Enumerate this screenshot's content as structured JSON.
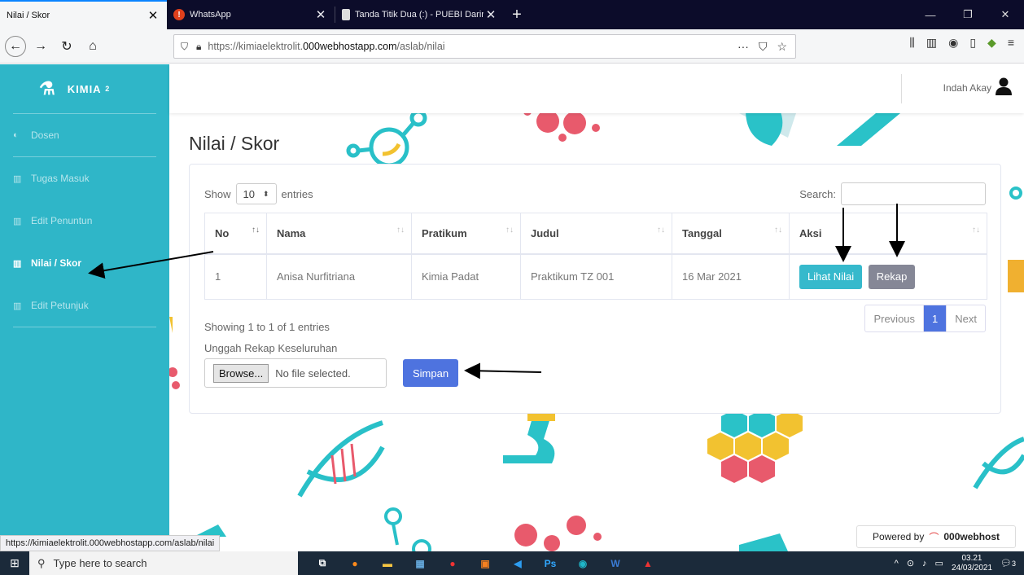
{
  "browser": {
    "tabs": [
      {
        "title": "Nilai / Skor",
        "icon": "page-icon"
      },
      {
        "title": "WhatsApp",
        "icon": "whatsapp-alert-icon"
      },
      {
        "title": "Tanda Titik Dua (:) - PUEBI Darin",
        "icon": "document-icon"
      }
    ],
    "url_prefix": "https://kimiaelektrolit.",
    "url_domain": "000webhostapp.com",
    "url_path": "/aslab/nilai",
    "status_url": "https://kimiaelektrolit.000webhostapp.com/aslab/nilai"
  },
  "app": {
    "brand": "KIMIA",
    "brand_sup": "2",
    "user_name": "Indah Akay",
    "sidebar": [
      {
        "label": "Dosen",
        "icon": "palette-icon",
        "active": false
      },
      {
        "label": "Tugas Masuk",
        "icon": "chart-icon",
        "active": false
      },
      {
        "label": "Edit Penuntun",
        "icon": "chart-icon",
        "active": false
      },
      {
        "label": "Nilai / Skor",
        "icon": "chart-icon",
        "active": true
      },
      {
        "label": "Edit Petunjuk",
        "icon": "chart-icon",
        "active": false
      }
    ],
    "page_title": "Nilai / Skor",
    "table": {
      "show_label": "Show",
      "entries_value": "10",
      "entries_label": "entries",
      "search_label": "Search:",
      "headers": [
        "No",
        "Nama",
        "Pratikum",
        "Judul",
        "Tanggal",
        "Aksi"
      ],
      "rows": [
        {
          "no": "1",
          "nama": "Anisa Nurfitriana",
          "pratikum": "Kimia Padat",
          "judul": "Praktikum TZ 001",
          "tanggal": "16 Mar 2021"
        }
      ],
      "btn_lihat": "Lihat Nilai",
      "btn_rekap": "Rekap",
      "info": "Showing 1 to 1 of 1 entries",
      "prev": "Previous",
      "page": "1",
      "next": "Next"
    },
    "upload_label": "Unggah Rekap Keseluruhan",
    "browse_label": "Browse...",
    "file_status": "No file selected.",
    "simpan_label": "Simpan",
    "powered_by": "Powered by",
    "powered_brand": "000webhost"
  },
  "taskbar": {
    "search_placeholder": "Type here to search",
    "time": "03.21",
    "date": "24/03/2021",
    "notif_count": "3"
  },
  "colors": {
    "sidebar": "#2fb6c8",
    "primary": "#4e73df",
    "info": "#36b9cc",
    "secondary": "#858796"
  }
}
